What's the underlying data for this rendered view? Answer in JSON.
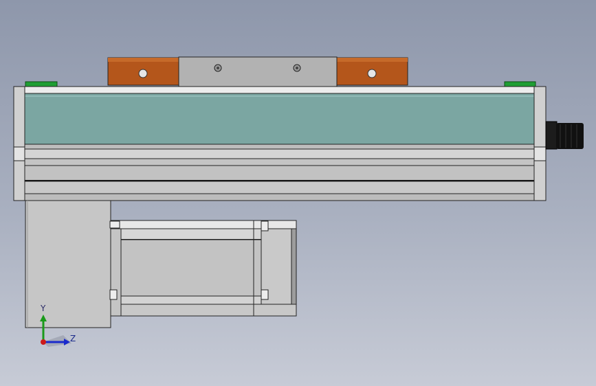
{
  "view": {
    "background_top": "#8e97ab",
    "background_bottom": "#c7cbd6"
  },
  "colors": {
    "rail_cover": "#7ba6a2",
    "frame": "#c9c9c9",
    "frame_dark": "#b3b3b3",
    "edge": "#222222",
    "carriage": "#b2b2b2",
    "wood_block": "#b4561b",
    "green_pad": "#1f9e33",
    "motor": "#c4c4c4",
    "connector": "#111111"
  },
  "triad": {
    "y_label": "Y",
    "z_label": "Z",
    "y_color": "#1a9a1a",
    "z_color": "#1a2acc",
    "x_color": "#cc1a1a"
  }
}
